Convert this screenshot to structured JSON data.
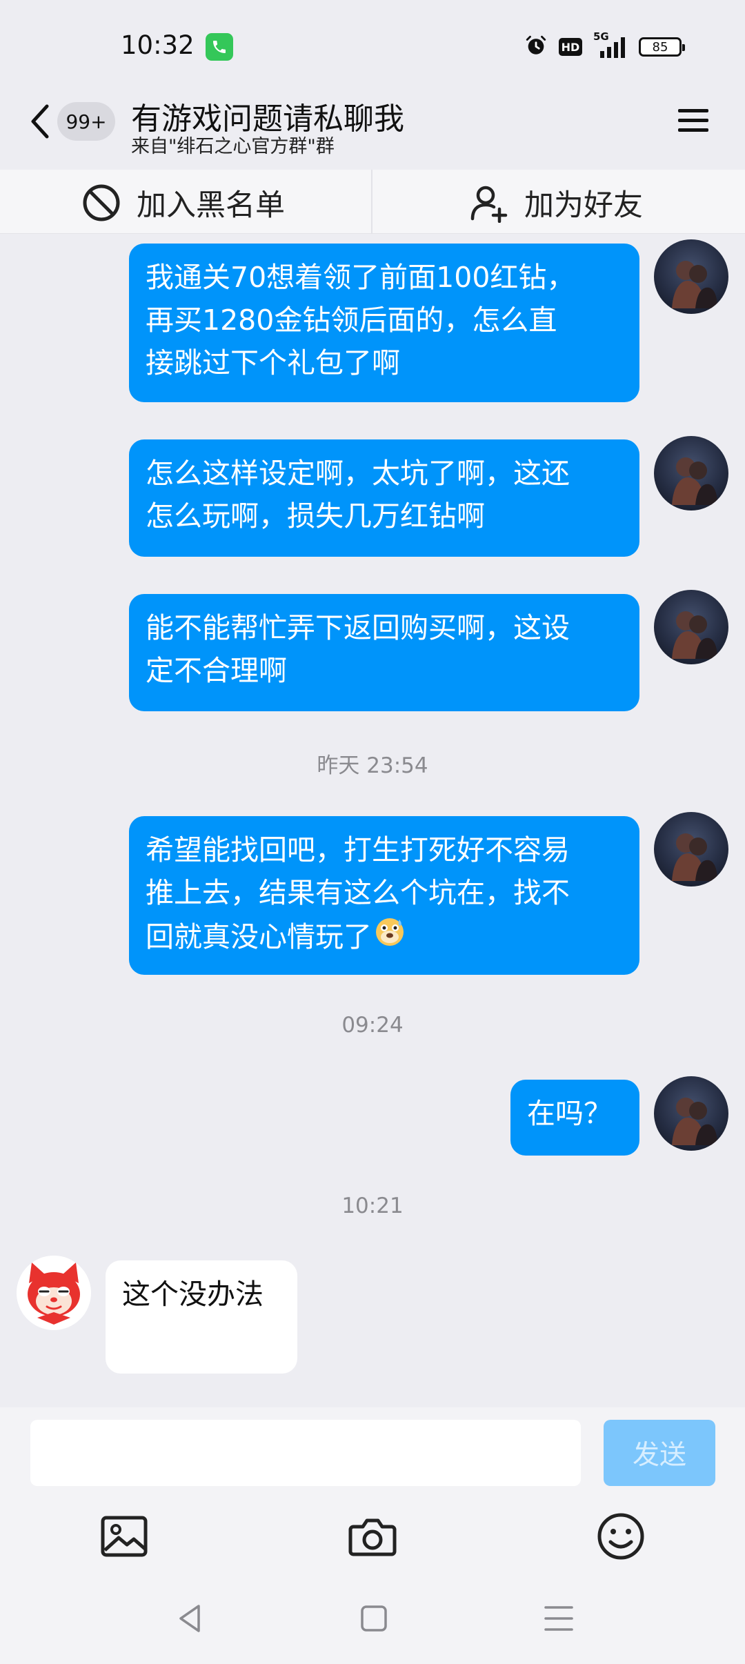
{
  "status_bar": {
    "time": "10:32",
    "hd_label": "HD",
    "network_label": "5G",
    "battery_level": "85"
  },
  "header": {
    "unread_count": "99+",
    "title": "有游戏问题请私聊我",
    "subtitle": "来自\"绯石之心官方群\"群"
  },
  "actions": {
    "block_label": "加入黑名单",
    "add_friend_label": "加为好友"
  },
  "messages": [
    {
      "side": "right",
      "lines": [
        "我通关70想着领了前面100红钻，",
        "再买1280金钻领后面的，怎么直",
        "接跳过下个礼包了啊"
      ]
    },
    {
      "side": "right",
      "lines": [
        "怎么这样设定啊，太坑了啊，这还",
        "怎么玩啊，损失几万红钻啊"
      ]
    },
    {
      "side": "right",
      "lines": [
        "能不能帮忙弄下返回购买啊，这设",
        "定不合理啊"
      ]
    },
    {
      "side": "right",
      "lines": [
        "希望能找回吧，打生打死好不容易",
        "推上去，结果有这么个坑在，找不",
        "回就真没心情玩了"
      ]
    },
    {
      "side": "right",
      "lines": [
        "在吗？"
      ]
    },
    {
      "side": "left",
      "lines": [
        "这个没办法"
      ]
    }
  ],
  "timestamps": [
    "昨天 23:54",
    "09:24",
    "10:21"
  ],
  "input": {
    "value": "",
    "placeholder": "",
    "send_label": "发送"
  },
  "colors": {
    "bubble_blue": "#0094fa",
    "send_disabled": "#7cc6fc",
    "background": "#ededf2"
  },
  "icons": [
    "phone-icon",
    "alarm-icon",
    "signal-icon",
    "battery-icon",
    "back-icon",
    "menu-icon",
    "block-icon",
    "add-friend-icon",
    "image-icon",
    "camera-icon",
    "emoji-icon",
    "nav-back-icon",
    "nav-home-icon",
    "nav-recents-icon"
  ]
}
